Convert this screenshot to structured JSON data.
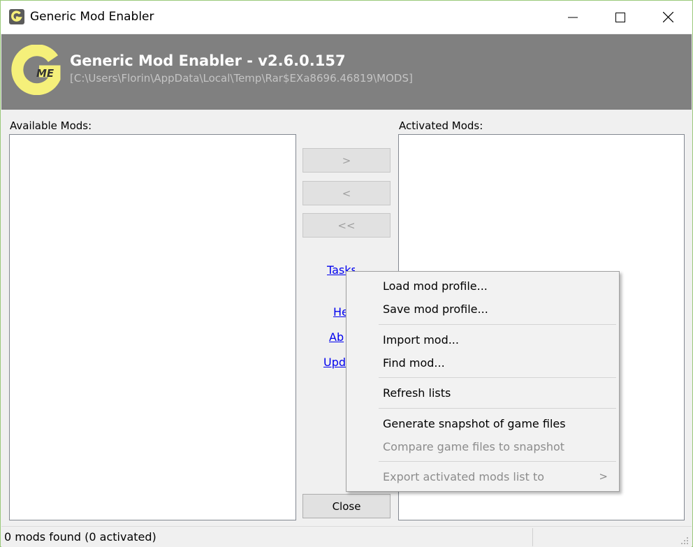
{
  "window": {
    "title": "Generic Mod Enabler"
  },
  "banner": {
    "title": "Generic Mod Enabler - v2.6.0.157",
    "path": "[C:\\Users\\Florin\\AppData\\Local\\Temp\\Rar$EXa8696.46819\\MODS]"
  },
  "available": {
    "label": "Available Mods:"
  },
  "activated": {
    "label": "Activated Mods:"
  },
  "buttons": {
    "activate": ">",
    "deactivate": "<",
    "deactivate_all": "<<",
    "close": "Close"
  },
  "links": {
    "tasks": "Tasks",
    "help": "He",
    "about": "Ab",
    "update": "Upd"
  },
  "menu": {
    "items": [
      {
        "label": "Load mod profile...",
        "enabled": true
      },
      {
        "label": "Save mod profile...",
        "enabled": true
      },
      {
        "label": "Import mod...",
        "enabled": true
      },
      {
        "label": "Find mod...",
        "enabled": true
      },
      {
        "label": "Refresh lists",
        "enabled": true
      },
      {
        "label": "Generate snapshot of game files",
        "enabled": true
      },
      {
        "label": "Compare game files to snapshot",
        "enabled": false
      },
      {
        "label": "Export activated mods list to",
        "enabled": false,
        "submenu": true
      }
    ],
    "submenu_arrow": ">"
  },
  "status": {
    "text": "0 mods found (0 activated)"
  },
  "colors": {
    "banner_bg": "#808080",
    "logo_yellow": "#f5f07a",
    "link": "#0000ee"
  }
}
